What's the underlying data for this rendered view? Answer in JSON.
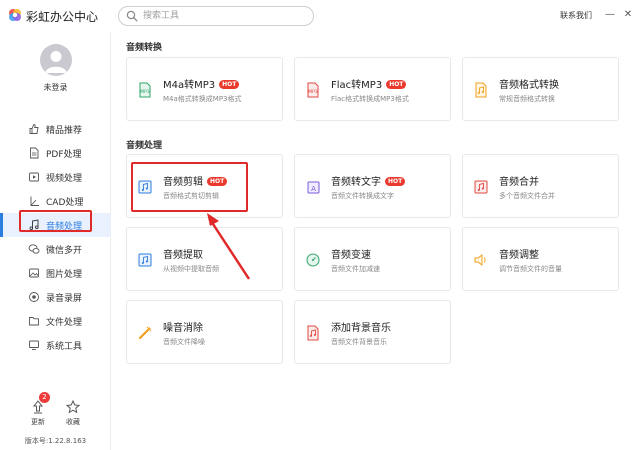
{
  "app": {
    "title": "彩虹办公中心",
    "contact": "联系我们",
    "minimize_glyph": "—",
    "close_glyph": "✕"
  },
  "search": {
    "placeholder": "搜索工具"
  },
  "user": {
    "login_label": "未登录"
  },
  "sidebar": {
    "items": [
      {
        "label": "精品推荐",
        "icon": "thumbs-up-icon"
      },
      {
        "label": "PDF处理",
        "icon": "pdf-icon"
      },
      {
        "label": "视频处理",
        "icon": "video-icon"
      },
      {
        "label": "CAD处理",
        "icon": "cad-icon"
      },
      {
        "label": "音频处理",
        "icon": "music-note-icon",
        "active": true
      },
      {
        "label": "微信多开",
        "icon": "wechat-icon"
      },
      {
        "label": "图片处理",
        "icon": "image-icon"
      },
      {
        "label": "录音录屏",
        "icon": "record-icon"
      },
      {
        "label": "文件处理",
        "icon": "folder-icon"
      },
      {
        "label": "系统工具",
        "icon": "monitor-icon"
      }
    ],
    "update_label": "更新",
    "update_badge": "2",
    "favorite_label": "收藏",
    "version": "版本号:1.22.8.163"
  },
  "sections": [
    {
      "title": "音频转换",
      "cards": [
        {
          "title": "M4a转MP3",
          "hot": true,
          "desc": "M4a格式转换成MP3格式",
          "icon": "m4a-icon"
        },
        {
          "title": "Flac转MP3",
          "hot": true,
          "desc": "Flac格式转换成MP3格式",
          "icon": "flac-icon"
        },
        {
          "title": "音频格式转换",
          "hot": false,
          "desc": "常规音频格式转换",
          "icon": "audio-format-icon"
        }
      ]
    },
    {
      "title": "音频处理",
      "cards": [
        {
          "title": "音频剪辑",
          "hot": true,
          "desc": "音频格式剪切剪辑",
          "icon": "audio-cut-icon"
        },
        {
          "title": "音频转文字",
          "hot": true,
          "desc": "音频文件转换成文字",
          "icon": "audio-to-text-icon"
        },
        {
          "title": "音频合并",
          "hot": false,
          "desc": "多个音频文件合并",
          "icon": "audio-merge-icon"
        },
        {
          "title": "音频提取",
          "hot": false,
          "desc": "从视频中提取音频",
          "icon": "audio-extract-icon"
        },
        {
          "title": "音频变速",
          "hot": false,
          "desc": "音频文件加减速",
          "icon": "audio-speed-icon"
        },
        {
          "title": "音频调整",
          "hot": false,
          "desc": "调节音频文件的音量",
          "icon": "volume-icon"
        },
        {
          "title": "噪音消除",
          "hot": false,
          "desc": "音频文件降噪",
          "icon": "noise-reduce-icon"
        },
        {
          "title": "添加背景音乐",
          "hot": false,
          "desc": "音频文件背景音乐",
          "icon": "bg-music-icon"
        }
      ]
    }
  ],
  "hot_label": "HOT",
  "colors": {
    "accent": "#2b7de0",
    "hot": "#ea3a2e",
    "annotation": "#e02a2a"
  }
}
